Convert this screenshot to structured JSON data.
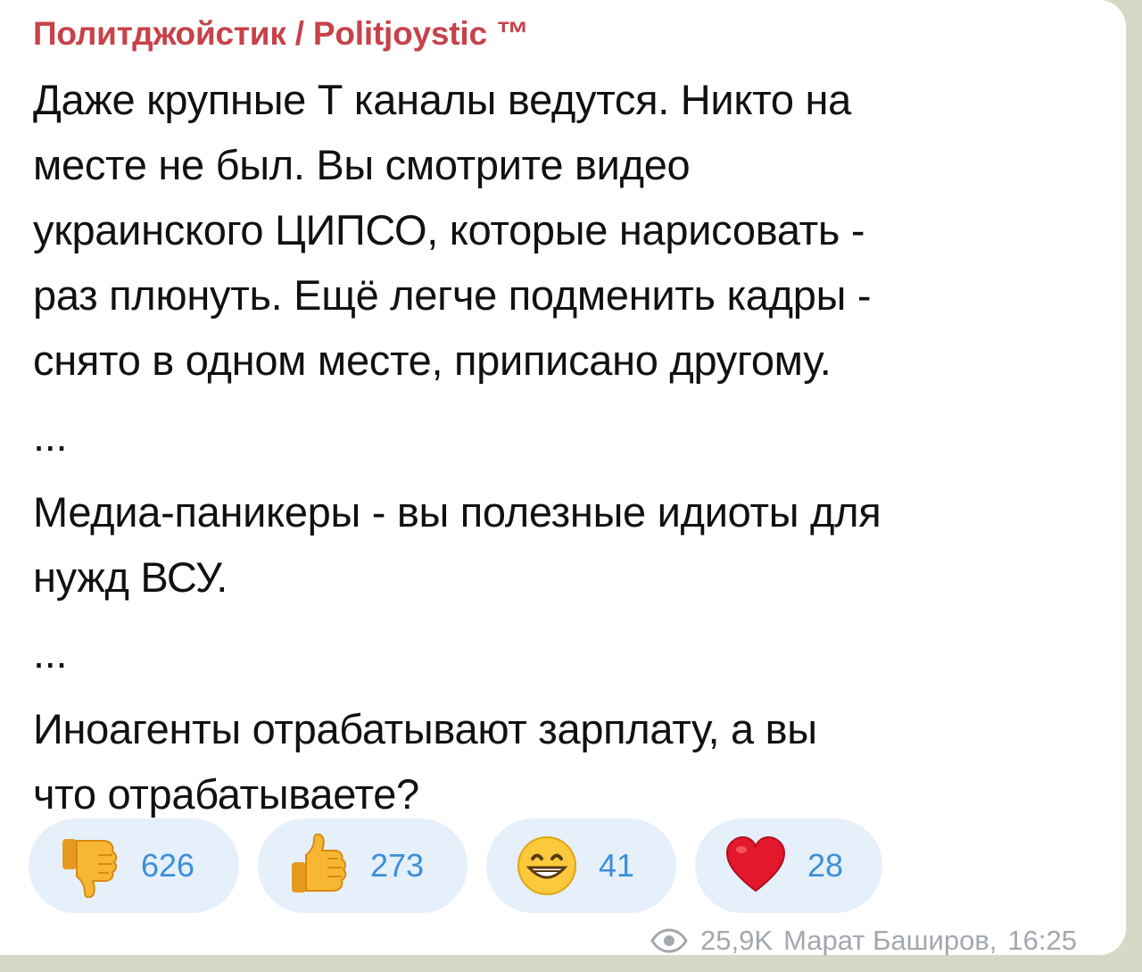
{
  "message": {
    "channel_name": "Политджойстик / Politjoystic ™",
    "paragraphs": [
      "Даже крупные Т каналы ведутся. Никто на\nместе не был. Вы смотрите видео\nукраинского ЦИПСО, которые нарисовать -\nраз плюнуть. Ещё легче подменить кадры -\nснято в одном месте, приписано другому.",
      "...",
      "Медиа-паникеры - вы полезные идиоты для\nнужд ВСУ.",
      "...",
      "Иноагенты отрабатывают зарплату, а вы\nчто отрабатываете?"
    ],
    "reactions": [
      {
        "emoji": "thumbs-down-icon",
        "count": "626"
      },
      {
        "emoji": "thumbs-up-icon",
        "count": "273"
      },
      {
        "emoji": "grinning-face-icon",
        "count": "41"
      },
      {
        "emoji": "red-heart-icon",
        "count": "28"
      }
    ],
    "views": "25,9K",
    "author": "Марат Баширов,",
    "time": "16:25"
  },
  "colors": {
    "channel_name": "#c7424b",
    "reaction_bg": "#e5f0fb",
    "reaction_count": "#3d8fd8",
    "meta": "#a3a8ad",
    "background": "#d7d9c6"
  }
}
